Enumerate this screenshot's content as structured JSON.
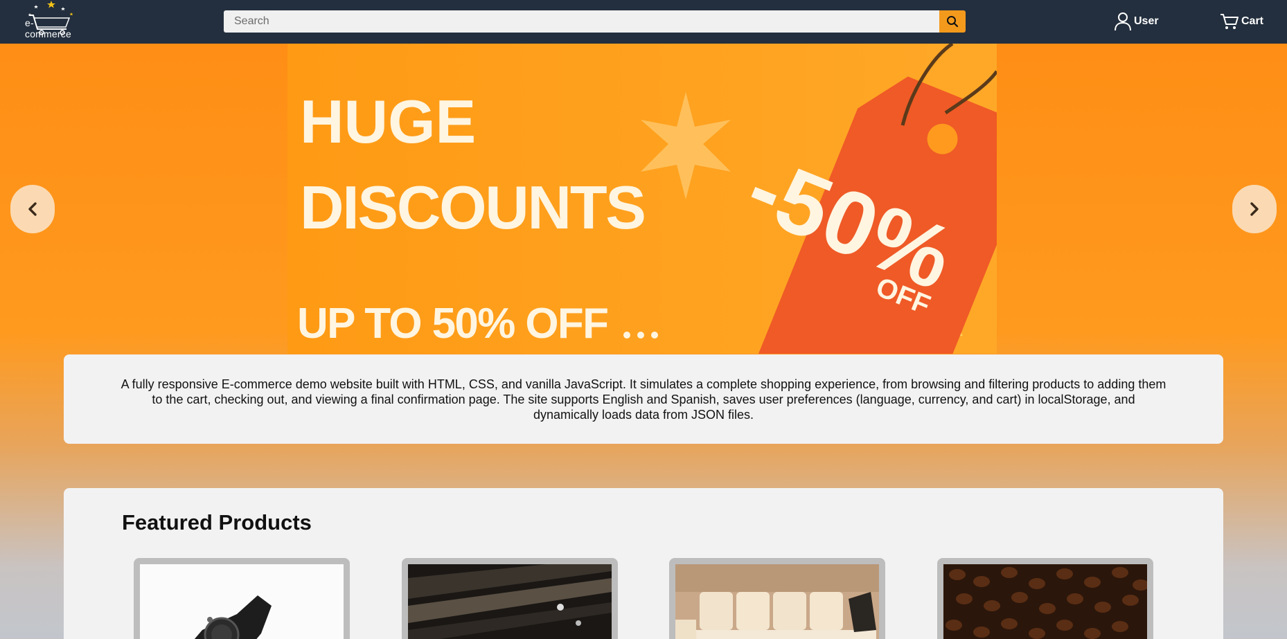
{
  "header": {
    "logo_text": "e-commerce",
    "search_placeholder": "Search",
    "user_label": "User",
    "cart_label": "Cart",
    "icons": {
      "logo": "shopping-cart-logo-icon",
      "search": "search-icon",
      "user": "user-icon",
      "cart": "cart-icon"
    }
  },
  "hero": {
    "line1": "HUGE",
    "line2": "DISCOUNTS",
    "line3": "UP TO 50% OFF",
    "tag_text": "-50%",
    "tag_sub": "OFF",
    "prev_icon": "chevron-left-icon",
    "next_icon": "chevron-right-icon"
  },
  "intro": {
    "text": "A fully responsive E-commerce demo website built with HTML, CSS, and vanilla JavaScript. It simulates a complete shopping experience, from browsing and filtering products to adding them to the cart, checking out, and viewing a final confirmation page. The site supports English and Spanish, saves user preferences (language, currency, and cart) in localStorage, and dynamically loads data from JSON files."
  },
  "featured": {
    "title": "Featured Products",
    "products": [
      {
        "image": "watch"
      },
      {
        "image": "dark-industrial"
      },
      {
        "image": "sofa"
      },
      {
        "image": "coffee-beans"
      }
    ]
  },
  "colors": {
    "header_bg": "#232f3e",
    "accent": "#f39a1d",
    "hero_orange": "#ff9a1e",
    "tag_red": "#ef5a26",
    "card_bg": "#f2f2f2"
  }
}
